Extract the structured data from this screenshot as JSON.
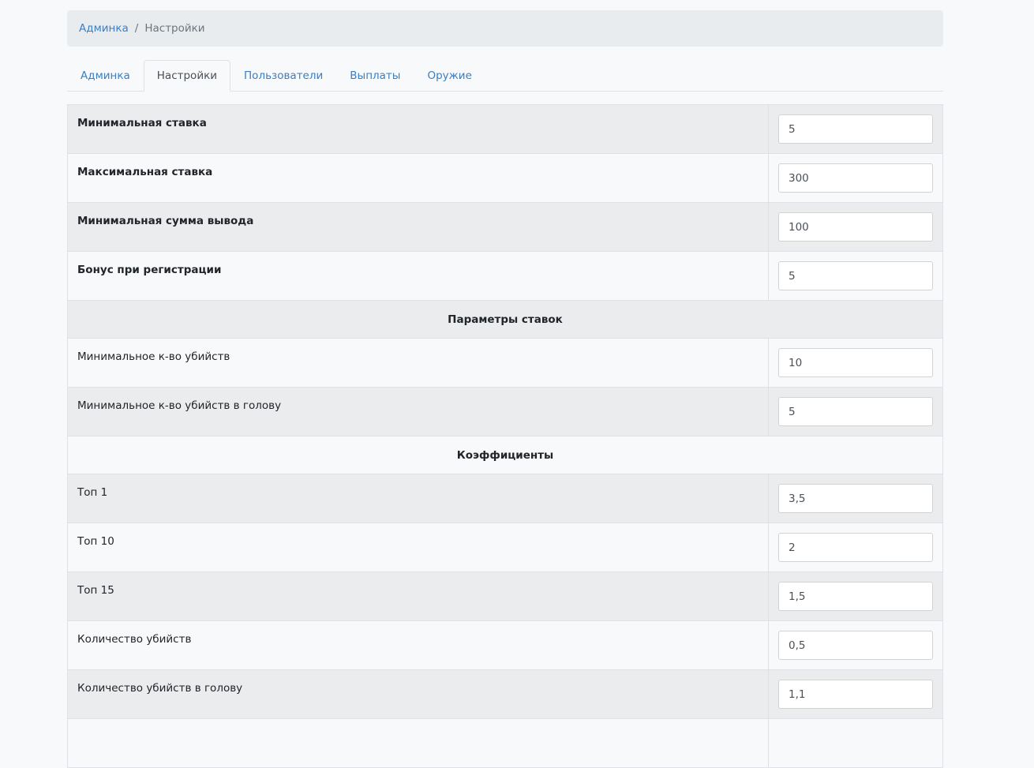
{
  "breadcrumb": {
    "home": "Админка",
    "separator": "/",
    "current": "Настройки"
  },
  "tabs": [
    {
      "label": "Админка",
      "active": false
    },
    {
      "label": "Настройки",
      "active": true
    },
    {
      "label": "Пользователи",
      "active": false
    },
    {
      "label": "Выплаты",
      "active": false
    },
    {
      "label": "Оружие",
      "active": false
    }
  ],
  "settings": {
    "general": [
      {
        "label": "Минимальная ставка",
        "value": "5"
      },
      {
        "label": "Максимальная ставка",
        "value": "300"
      },
      {
        "label": "Минимальная сумма вывода",
        "value": "100"
      },
      {
        "label": "Бонус при регистрации",
        "value": "5"
      }
    ],
    "bet_params_header": "Параметры ставок",
    "bet_params": [
      {
        "label": "Минимальное к-во убийств",
        "value": "10"
      },
      {
        "label": "Минимальное к-во убийств в голову",
        "value": "5"
      }
    ],
    "coefficients_header": "Коэффициенты",
    "coefficients": [
      {
        "label": "Топ 1",
        "value": "3,5"
      },
      {
        "label": "Топ 10",
        "value": "2"
      },
      {
        "label": "Топ 15",
        "value": "1,5"
      },
      {
        "label": "Количество убийств",
        "value": "0,5"
      },
      {
        "label": "Количество убийств в голову",
        "value": "1,1"
      }
    ]
  },
  "colors": {
    "link": "#3a7ec4",
    "row_odd": "#ebecee",
    "row_even": "#f8f9fa",
    "breadcrumb_bg": "#e9ecef"
  }
}
